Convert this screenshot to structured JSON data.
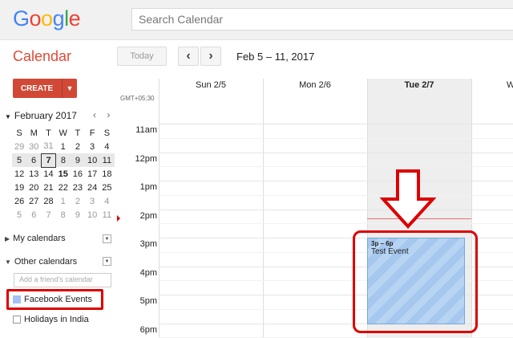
{
  "app": {
    "logo_letters": [
      {
        "ch": "G",
        "color": "#4285f4"
      },
      {
        "ch": "o",
        "color": "#ea4335"
      },
      {
        "ch": "o",
        "color": "#fbbc05"
      },
      {
        "ch": "g",
        "color": "#4285f4"
      },
      {
        "ch": "l",
        "color": "#34a853"
      },
      {
        "ch": "e",
        "color": "#ea4335"
      }
    ],
    "search_placeholder": "Search Calendar",
    "title": "Calendar"
  },
  "toolbar": {
    "today_label": "Today",
    "prev_icon": "‹",
    "next_icon": "›",
    "date_range": "Feb 5 – 11, 2017"
  },
  "create": {
    "label": "CREATE",
    "dropdown_icon": "▼"
  },
  "mini_calendar": {
    "month_label": "February 2017",
    "prev": "‹",
    "next": "›",
    "weekdays": [
      "S",
      "M",
      "T",
      "W",
      "T",
      "F",
      "S"
    ],
    "weeks": [
      [
        "29",
        "30",
        "31",
        "1",
        "2",
        "3",
        "4"
      ],
      [
        "5",
        "6",
        "7",
        "8",
        "9",
        "10",
        "11"
      ],
      [
        "12",
        "13",
        "14",
        "15",
        "16",
        "17",
        "18"
      ],
      [
        "19",
        "20",
        "21",
        "22",
        "23",
        "24",
        "25"
      ],
      [
        "26",
        "27",
        "28",
        "1",
        "2",
        "3",
        "4"
      ],
      [
        "5",
        "6",
        "7",
        "8",
        "9",
        "10",
        "11"
      ]
    ]
  },
  "sidebar": {
    "my_calendars": "My calendars",
    "other_calendars": "Other calendars",
    "add_friend_placeholder": "Add a friend's calendar",
    "calendars": [
      {
        "name": "Facebook Events",
        "color": "#a4c2f4"
      },
      {
        "name": "Holidays in India",
        "color": "#ffffff"
      }
    ]
  },
  "week_view": {
    "timezone": "GMT+05:30",
    "columns": [
      "Sun 2/5",
      "Mon 2/6",
      "Tue 2/7",
      "W"
    ],
    "hours": [
      "11am",
      "12pm",
      "1pm",
      "2pm",
      "3pm",
      "4pm",
      "5pm",
      "6pm"
    ]
  },
  "event": {
    "time": "3p – 6p",
    "title": "Test Event",
    "color": "#a6c7ee"
  },
  "annotation": {
    "arrow_icon": "down-arrow-icon",
    "highlight_color": "#dd0000"
  }
}
